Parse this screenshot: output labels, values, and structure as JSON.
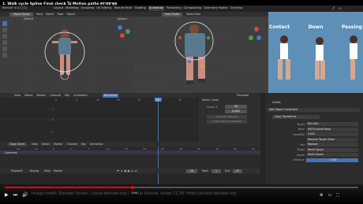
{
  "video": {
    "title": "1. Walk cycle Spline Final check ไม่ Motion paths ตรวจหาผล",
    "scrub_time": "1:56",
    "watermark": "Image credit: Blender Studio | cloud.blender.org | Studio license: under CC BY https://studio.blender.org"
  },
  "blender": {
    "window_title": "Blender 4.0.1 [C]",
    "menu": [
      "File",
      "Edit",
      "Render",
      "Window",
      "Help"
    ],
    "workspaces": [
      "Layout",
      "Modeling",
      "Sculpting",
      "UV Editing",
      "Texture Paint",
      "Shading",
      "Animation",
      "Rendering",
      "Compositing",
      "Geometry Nodes",
      "Scripting"
    ],
    "active_workspace": "Animation",
    "mode_left": "Object Mode",
    "mode_right": "Pose Mode",
    "orientation": "Default",
    "select_box": "Select Box",
    "view_menus": [
      "View",
      "Select",
      "Pose",
      "Object"
    ],
    "transform_options": "Options"
  },
  "reference": {
    "labels": [
      "Contact",
      "Down",
      "Passing"
    ]
  },
  "graph_editor": {
    "menus": [
      "View",
      "Select",
      "Marker",
      "Channel",
      "Key",
      "Animation"
    ],
    "mode": "Normalize",
    "ruler": [
      "0",
      "5",
      "10",
      "15",
      "20",
      "25",
      "30",
      "35",
      "40",
      "45",
      "50"
    ],
    "current_frame": "20",
    "y_labels": [
      "1",
      "0",
      "-1"
    ],
    "sidebar_title": "Show Cursor",
    "cursor_x_label": "Cursor X",
    "cursor_x_value": "20",
    "cursor_y_value": "0.000",
    "cursor_to_selection": "Cursor to Selection",
    "cursor_value_to_selection": "Cursor Value to Selection",
    "playhead_label": "Playhead"
  },
  "dopesheet": {
    "mode": "Dope Sheet",
    "menus": [
      "View",
      "Select",
      "Marker",
      "Channel",
      "Key",
      "Animation"
    ],
    "summary": "Summary",
    "ruler": [
      "-15",
      "-10",
      "-5",
      "0",
      "5",
      "10",
      "15",
      "20",
      "25",
      "30",
      "35",
      "40",
      "45",
      "50"
    ]
  },
  "timeline": {
    "playback": "Playback",
    "keying": "Keying",
    "view": "View",
    "marker": "Marker",
    "current": "20",
    "start_label": "Start",
    "start": "1",
    "end_label": "End",
    "end": "25"
  },
  "properties": {
    "title": "Limits",
    "add_constraint": "Add Object Constraint",
    "constraint_name": "Copy Transforms",
    "fields": [
      {
        "label": "Target",
        "value": "RIG-Ellie"
      },
      {
        "label": "Bone",
        "value": "MSTR-Spline-Temp"
      },
      {
        "label": "Head/Tail",
        "value": "0.000"
      },
      {
        "label": "",
        "value": "Remove Target Shear"
      },
      {
        "label": "Mix",
        "value": "Replace"
      },
      {
        "label": "Target",
        "value": "World Space"
      },
      {
        "label": "Owner",
        "value": "World Space"
      },
      {
        "label": "Influence",
        "value": "1.000"
      }
    ]
  },
  "colors": {
    "accent": "#4772b3",
    "keyframe": "#e0c040",
    "playhead": "#4a86d8",
    "spacer": "#1b1b1b"
  }
}
